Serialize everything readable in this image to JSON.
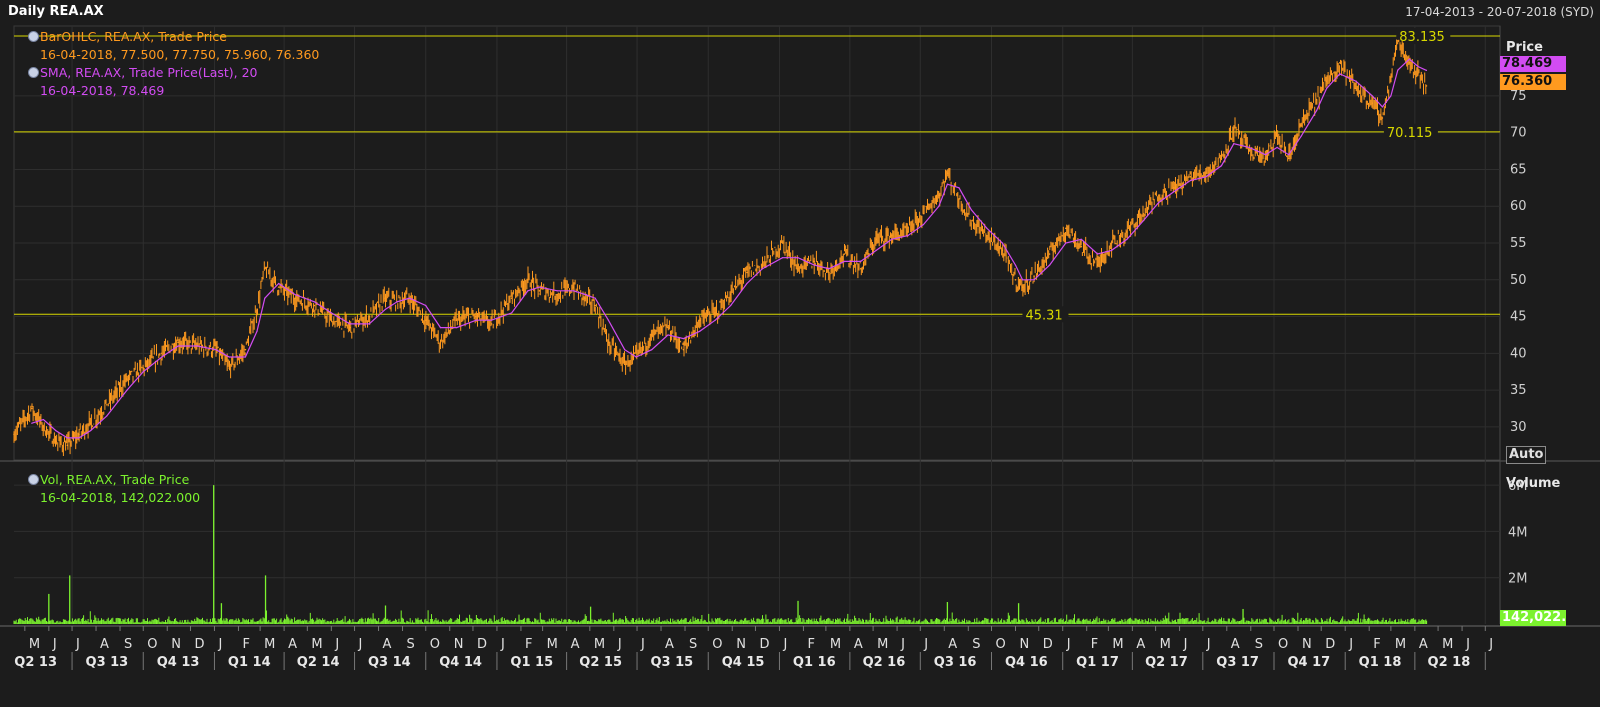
{
  "window": {
    "title": "Daily REA.AX",
    "date_range": "17-04-2013 - 20-07-2018 (SYD)"
  },
  "legend": {
    "ohlc_name": "BarOHLC, REA.AX, Trade Price",
    "ohlc_values": "16-04-2018, 77.500, 77.750, 75.960, 76.360",
    "sma_name": "SMA, REA.AX, Trade Price(Last),  20",
    "sma_values": "16-04-2018, 78.469",
    "vol_name": "Vol, REA.AX, Trade Price",
    "vol_values": "16-04-2018, 142,022.000"
  },
  "price_axis": {
    "label": "Price",
    "sma_tag": "78.469",
    "last_tag": "76.360",
    "auto_button": "Auto"
  },
  "volume_axis": {
    "label": "Volume",
    "last_tag": "142,022.0"
  },
  "colors": {
    "price": "#ff9a1f",
    "sma": "#d24cf2",
    "volume": "#7cf22e",
    "hline": "#d8d800",
    "background": "#1c1c1c",
    "grid": "#2e2e2e"
  },
  "chart_data": {
    "type": "line",
    "x_start": "2013-04-17",
    "x_end": "2018-07-20",
    "last_data_date": "2018-04-16",
    "price_ticks": [
      30,
      35,
      40,
      45,
      50,
      55,
      60,
      65,
      70,
      75
    ],
    "price_ylim": [
      25.5,
      84.5
    ],
    "volume_ticks": [
      {
        "value": 2000000,
        "label": "2M"
      },
      {
        "value": 4000000,
        "label": "4M"
      },
      {
        "value": 6000000,
        "label": "6M"
      }
    ],
    "volume_ylim": [
      0,
      7000000
    ],
    "horizontal_lines": [
      {
        "value": 83.135,
        "label": "83.135",
        "label_date": "2018-03-08"
      },
      {
        "value": 70.115,
        "label": "70.115",
        "label_date": "2018-02-20"
      },
      {
        "value": 45.31,
        "label": "45.31",
        "label_date": "2016-11-10"
      }
    ],
    "month_labels": [
      {
        "date": "2013-05-01",
        "label": "M"
      },
      {
        "date": "2013-06-01",
        "label": "J"
      },
      {
        "date": "2013-07-01",
        "label": "J"
      },
      {
        "date": "2013-08-01",
        "label": "A"
      },
      {
        "date": "2013-09-01",
        "label": "S"
      },
      {
        "date": "2013-10-01",
        "label": "O"
      },
      {
        "date": "2013-11-01",
        "label": "N"
      },
      {
        "date": "2013-12-01",
        "label": "D"
      },
      {
        "date": "2014-01-01",
        "label": "J"
      },
      {
        "date": "2014-02-01",
        "label": "F"
      },
      {
        "date": "2014-03-01",
        "label": "M"
      },
      {
        "date": "2014-04-01",
        "label": "A"
      },
      {
        "date": "2014-05-01",
        "label": "M"
      },
      {
        "date": "2014-06-01",
        "label": "J"
      },
      {
        "date": "2014-07-01",
        "label": "J"
      },
      {
        "date": "2014-08-01",
        "label": "A"
      },
      {
        "date": "2014-09-01",
        "label": "S"
      },
      {
        "date": "2014-10-01",
        "label": "O"
      },
      {
        "date": "2014-11-01",
        "label": "N"
      },
      {
        "date": "2014-12-01",
        "label": "D"
      },
      {
        "date": "2015-01-01",
        "label": "J"
      },
      {
        "date": "2015-02-01",
        "label": "F"
      },
      {
        "date": "2015-03-01",
        "label": "M"
      },
      {
        "date": "2015-04-01",
        "label": "A"
      },
      {
        "date": "2015-05-01",
        "label": "M"
      },
      {
        "date": "2015-06-01",
        "label": "J"
      },
      {
        "date": "2015-07-01",
        "label": "J"
      },
      {
        "date": "2015-08-01",
        "label": "A"
      },
      {
        "date": "2015-09-01",
        "label": "S"
      },
      {
        "date": "2015-10-01",
        "label": "O"
      },
      {
        "date": "2015-11-01",
        "label": "N"
      },
      {
        "date": "2015-12-01",
        "label": "D"
      },
      {
        "date": "2016-01-01",
        "label": "J"
      },
      {
        "date": "2016-02-01",
        "label": "F"
      },
      {
        "date": "2016-03-01",
        "label": "M"
      },
      {
        "date": "2016-04-01",
        "label": "A"
      },
      {
        "date": "2016-05-01",
        "label": "M"
      },
      {
        "date": "2016-06-01",
        "label": "J"
      },
      {
        "date": "2016-07-01",
        "label": "J"
      },
      {
        "date": "2016-08-01",
        "label": "A"
      },
      {
        "date": "2016-09-01",
        "label": "S"
      },
      {
        "date": "2016-10-01",
        "label": "O"
      },
      {
        "date": "2016-11-01",
        "label": "N"
      },
      {
        "date": "2016-12-01",
        "label": "D"
      },
      {
        "date": "2017-01-01",
        "label": "J"
      },
      {
        "date": "2017-02-01",
        "label": "F"
      },
      {
        "date": "2017-03-01",
        "label": "M"
      },
      {
        "date": "2017-04-01",
        "label": "A"
      },
      {
        "date": "2017-05-01",
        "label": "M"
      },
      {
        "date": "2017-06-01",
        "label": "J"
      },
      {
        "date": "2017-07-01",
        "label": "J"
      },
      {
        "date": "2017-08-01",
        "label": "A"
      },
      {
        "date": "2017-09-01",
        "label": "S"
      },
      {
        "date": "2017-10-01",
        "label": "O"
      },
      {
        "date": "2017-11-01",
        "label": "N"
      },
      {
        "date": "2017-12-01",
        "label": "D"
      },
      {
        "date": "2018-01-01",
        "label": "J"
      },
      {
        "date": "2018-02-01",
        "label": "F"
      },
      {
        "date": "2018-03-01",
        "label": "M"
      },
      {
        "date": "2018-04-01",
        "label": "A"
      },
      {
        "date": "2018-05-01",
        "label": "M"
      },
      {
        "date": "2018-06-01",
        "label": "J"
      },
      {
        "date": "2018-07-01",
        "label": "J"
      }
    ],
    "quarter_labels": [
      {
        "date": "2013-05-15",
        "label": "Q2 13"
      },
      {
        "date": "2013-08-15",
        "label": "Q3 13"
      },
      {
        "date": "2013-11-15",
        "label": "Q4 13"
      },
      {
        "date": "2014-02-15",
        "label": "Q1 14"
      },
      {
        "date": "2014-05-15",
        "label": "Q2 14"
      },
      {
        "date": "2014-08-15",
        "label": "Q3 14"
      },
      {
        "date": "2014-11-15",
        "label": "Q4 14"
      },
      {
        "date": "2015-02-15",
        "label": "Q1 15"
      },
      {
        "date": "2015-05-15",
        "label": "Q2 15"
      },
      {
        "date": "2015-08-15",
        "label": "Q3 15"
      },
      {
        "date": "2015-11-15",
        "label": "Q4 15"
      },
      {
        "date": "2016-02-15",
        "label": "Q1 16"
      },
      {
        "date": "2016-05-15",
        "label": "Q2 16"
      },
      {
        "date": "2016-08-15",
        "label": "Q3 16"
      },
      {
        "date": "2016-11-15",
        "label": "Q4 16"
      },
      {
        "date": "2017-02-15",
        "label": "Q1 17"
      },
      {
        "date": "2017-05-15",
        "label": "Q2 17"
      },
      {
        "date": "2017-08-15",
        "label": "Q3 17"
      },
      {
        "date": "2017-11-15",
        "label": "Q4 17"
      },
      {
        "date": "2018-02-15",
        "label": "Q1 18"
      },
      {
        "date": "2018-05-15",
        "label": "Q2 18"
      }
    ],
    "quarter_starts": [
      "2013-07-01",
      "2013-10-01",
      "2014-01-01",
      "2014-04-01",
      "2014-07-01",
      "2014-10-01",
      "2015-01-01",
      "2015-04-01",
      "2015-07-01",
      "2015-10-01",
      "2016-01-01",
      "2016-04-01",
      "2016-07-01",
      "2016-10-01",
      "2017-01-01",
      "2017-04-01",
      "2017-07-01",
      "2017-10-01",
      "2018-01-01",
      "2018-04-01",
      "2018-07-01"
    ],
    "series": [
      {
        "name": "BarOHLC, REA.AX, Trade Price",
        "dates": [
          "2013-04-17",
          "2013-05-10",
          "2013-05-25",
          "2013-06-10",
          "2013-06-25",
          "2013-07-10",
          "2013-07-25",
          "2013-08-15",
          "2013-09-10",
          "2013-10-01",
          "2013-10-25",
          "2013-11-15",
          "2013-12-10",
          "2014-01-03",
          "2014-01-20",
          "2014-02-10",
          "2014-02-25",
          "2014-03-07",
          "2014-03-25",
          "2014-04-15",
          "2014-05-10",
          "2014-06-01",
          "2014-06-25",
          "2014-07-20",
          "2014-08-10",
          "2014-08-25",
          "2014-09-10",
          "2014-10-01",
          "2014-10-20",
          "2014-11-10",
          "2014-12-05",
          "2014-12-25",
          "2015-01-20",
          "2015-02-10",
          "2015-02-25",
          "2015-03-20",
          "2015-04-10",
          "2015-04-25",
          "2015-05-08",
          "2015-05-25",
          "2015-06-15",
          "2015-06-30",
          "2015-07-20",
          "2015-08-10",
          "2015-08-30",
          "2015-09-20",
          "2015-10-10",
          "2015-10-30",
          "2015-11-20",
          "2015-12-10",
          "2016-01-05",
          "2016-01-25",
          "2016-02-15",
          "2016-03-05",
          "2016-03-25",
          "2016-04-15",
          "2016-05-05",
          "2016-05-25",
          "2016-06-15",
          "2016-07-05",
          "2016-07-25",
          "2016-08-05",
          "2016-08-20",
          "2016-09-05",
          "2016-09-25",
          "2016-10-15",
          "2016-11-01",
          "2016-11-10",
          "2016-11-25",
          "2016-12-15",
          "2017-01-05",
          "2017-01-25",
          "2017-02-15",
          "2017-03-05",
          "2017-03-25",
          "2017-04-15",
          "2017-05-05",
          "2017-05-25",
          "2017-06-15",
          "2017-07-05",
          "2017-07-25",
          "2017-08-10",
          "2017-08-30",
          "2017-09-20",
          "2017-10-05",
          "2017-10-20",
          "2017-11-05",
          "2017-11-25",
          "2017-12-08",
          "2017-12-25",
          "2018-01-15",
          "2018-02-05",
          "2018-02-18",
          "2018-03-01",
          "2018-03-10",
          "2018-03-25",
          "2018-04-05",
          "2018-04-16"
        ],
        "values": [
          29.0,
          32.5,
          30.0,
          28.0,
          27.5,
          29.0,
          30.5,
          33.0,
          36.5,
          38.0,
          40.0,
          41.5,
          41.0,
          40.5,
          38.0,
          40.5,
          46.0,
          51.5,
          49.0,
          47.5,
          46.5,
          44.5,
          43.5,
          45.0,
          47.5,
          47.0,
          47.5,
          44.5,
          41.5,
          44.5,
          45.0,
          44.0,
          47.5,
          50.0,
          48.5,
          48.0,
          49.0,
          47.5,
          46.5,
          41.5,
          38.5,
          39.5,
          42.5,
          43.5,
          40.5,
          44.5,
          45.5,
          48.0,
          51.0,
          52.0,
          55.0,
          51.5,
          52.5,
          51.0,
          53.5,
          51.5,
          55.5,
          56.0,
          56.5,
          59.0,
          61.5,
          64.5,
          61.0,
          58.0,
          56.0,
          54.0,
          50.0,
          49.0,
          50.5,
          53.5,
          57.0,
          54.5,
          52.0,
          55.0,
          56.5,
          59.0,
          61.5,
          62.5,
          64.0,
          64.5,
          66.5,
          70.5,
          67.5,
          66.5,
          69.5,
          66.5,
          71.0,
          74.5,
          77.0,
          79.5,
          76.0,
          74.0,
          72.0,
          77.5,
          82.5,
          79.5,
          78.0,
          76.36
        ]
      },
      {
        "name": "SMA, REA.AX, Trade Price(Last),  20",
        "dates": [
          "2013-05-10",
          "2013-05-25",
          "2013-06-10",
          "2013-06-25",
          "2013-07-10",
          "2013-07-25",
          "2013-08-15",
          "2013-09-10",
          "2013-10-01",
          "2013-10-25",
          "2013-11-15",
          "2013-12-10",
          "2014-01-03",
          "2014-01-20",
          "2014-02-10",
          "2014-02-25",
          "2014-03-07",
          "2014-03-25",
          "2014-04-15",
          "2014-05-10",
          "2014-06-01",
          "2014-06-25",
          "2014-07-20",
          "2014-08-10",
          "2014-08-25",
          "2014-09-10",
          "2014-10-01",
          "2014-10-20",
          "2014-11-10",
          "2014-12-05",
          "2014-12-25",
          "2015-01-20",
          "2015-02-10",
          "2015-02-25",
          "2015-03-20",
          "2015-04-10",
          "2015-04-25",
          "2015-05-08",
          "2015-05-25",
          "2015-06-15",
          "2015-06-30",
          "2015-07-20",
          "2015-08-10",
          "2015-08-30",
          "2015-09-20",
          "2015-10-10",
          "2015-10-30",
          "2015-11-20",
          "2015-12-10",
          "2016-01-05",
          "2016-01-25",
          "2016-02-15",
          "2016-03-05",
          "2016-03-25",
          "2016-04-15",
          "2016-05-05",
          "2016-05-25",
          "2016-06-15",
          "2016-07-05",
          "2016-07-25",
          "2016-08-05",
          "2016-08-20",
          "2016-09-05",
          "2016-09-25",
          "2016-10-15",
          "2016-11-01",
          "2016-11-10",
          "2016-11-25",
          "2016-12-15",
          "2017-01-05",
          "2017-01-25",
          "2017-02-15",
          "2017-03-05",
          "2017-03-25",
          "2017-04-15",
          "2017-05-05",
          "2017-05-25",
          "2017-06-15",
          "2017-07-05",
          "2017-07-25",
          "2017-08-10",
          "2017-08-30",
          "2017-09-20",
          "2017-10-05",
          "2017-10-20",
          "2017-11-05",
          "2017-11-25",
          "2017-12-08",
          "2017-12-25",
          "2018-01-15",
          "2018-02-05",
          "2018-02-18",
          "2018-03-01",
          "2018-03-10",
          "2018-03-25",
          "2018-04-05",
          "2018-04-16"
        ],
        "values": [
          30.5,
          31.0,
          29.5,
          28.5,
          28.5,
          29.5,
          31.5,
          35.0,
          37.5,
          39.5,
          41.0,
          41.0,
          40.5,
          39.5,
          39.5,
          43.0,
          47.5,
          49.5,
          48.0,
          47.0,
          45.5,
          44.0,
          44.0,
          46.0,
          47.0,
          47.5,
          46.5,
          43.5,
          43.5,
          44.5,
          44.5,
          45.5,
          48.5,
          49.0,
          48.5,
          48.5,
          48.0,
          47.5,
          44.5,
          40.5,
          39.5,
          40.5,
          42.5,
          42.0,
          43.0,
          44.5,
          46.5,
          49.5,
          51.5,
          53.0,
          53.0,
          52.0,
          51.5,
          52.5,
          52.5,
          54.0,
          55.5,
          56.0,
          57.5,
          60.0,
          63.0,
          62.5,
          59.5,
          57.0,
          55.0,
          52.0,
          50.0,
          50.0,
          52.0,
          55.0,
          55.5,
          53.5,
          54.0,
          55.5,
          58.0,
          60.5,
          62.0,
          63.5,
          64.0,
          65.5,
          68.5,
          68.0,
          67.0,
          68.0,
          67.0,
          69.5,
          73.0,
          76.0,
          78.0,
          77.0,
          75.0,
          73.5,
          75.0,
          78.5,
          80.0,
          79.0,
          78.469
        ]
      },
      {
        "name": "Vol, REA.AX, Trade Price",
        "baseline": 150000,
        "spikes": [
          {
            "date": "2013-06-01",
            "value": 1300000
          },
          {
            "date": "2013-06-28",
            "value": 2100000
          },
          {
            "date": "2013-12-31",
            "value": 6000000
          },
          {
            "date": "2014-01-10",
            "value": 900000
          },
          {
            "date": "2014-03-08",
            "value": 2100000
          },
          {
            "date": "2014-08-10",
            "value": 800000
          },
          {
            "date": "2015-05-02",
            "value": 750000
          },
          {
            "date": "2016-01-25",
            "value": 1000000
          },
          {
            "date": "2016-08-05",
            "value": 950000
          },
          {
            "date": "2016-11-05",
            "value": 900000
          },
          {
            "date": "2017-08-22",
            "value": 650000
          },
          {
            "date": "2018-04-16",
            "value": 142022
          }
        ]
      }
    ]
  }
}
